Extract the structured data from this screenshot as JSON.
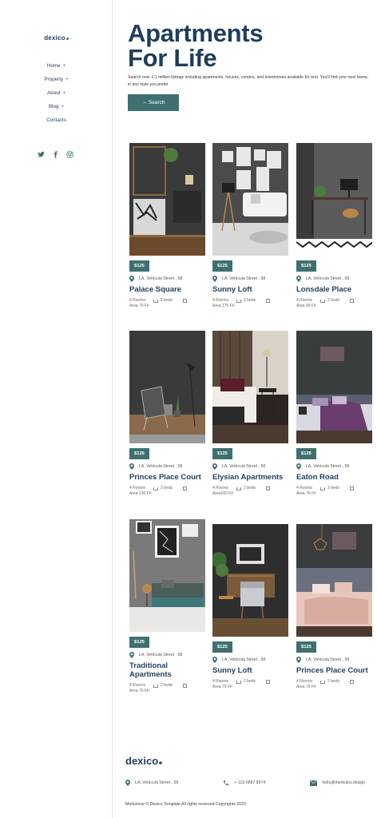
{
  "sidebar": {
    "logo": "dexico",
    "nav": [
      {
        "label": "Home",
        "plus": "+"
      },
      {
        "label": "Property",
        "plus": "+"
      },
      {
        "label": "About",
        "plus": "+"
      },
      {
        "label": "Blog",
        "plus": "+"
      },
      {
        "label": "Contacts",
        "plus": ""
      }
    ],
    "social": [
      "twitter-icon",
      "facebook-icon",
      "instagram-icon"
    ]
  },
  "hero": {
    "title_line1": "Apartments",
    "title_line2": "For Life",
    "description": "Search over 1.1 million listings including apartments, houses, condos, and townhomes available for rent. You'll find your next home, in any style you prefer",
    "search_label": "→ Search"
  },
  "listings": [
    {
      "price": "$125",
      "location": "LA, Vehicula Street , 58",
      "name": "Palace Square",
      "rooms": "4 Rooms",
      "beds": "2 beds",
      "area": "Area 70 Ft²",
      "theme": "dark-botanical"
    },
    {
      "price": "$125",
      "location": "LA, Vehicula Street , 58",
      "name": "Sunny Loft",
      "rooms": "4 Rooms",
      "beds": "2 beds",
      "area": "Area 170 Ft²",
      "theme": "gallery-sofa"
    },
    {
      "price": "$125",
      "location": "LA, Vehicula Street , 58",
      "name": "Lonsdale Place",
      "rooms": "4 Rooms",
      "beds": "2 beds",
      "area": "Area 90 Ft²",
      "theme": "desk-corner"
    },
    {
      "price": "$125",
      "location": "LA, Vehicula Street , 58",
      "name": "Princes Place Court",
      "rooms": "4 Rooms",
      "beds": "2 beds",
      "area": "Area 130 Ft²",
      "theme": "grey-chair"
    },
    {
      "price": "$125",
      "location": "LA, Vehicula Street , 58",
      "name": "Elysian Apartments",
      "rooms": "4 Rooms",
      "beds": "2 beds",
      "area": "Area100 Ft²",
      "theme": "wood-bedroom"
    },
    {
      "price": "$125",
      "location": "LA, Vehicula Street , 58",
      "name": "Eaton Road",
      "rooms": "4 Rooms",
      "beds": "2 beds",
      "area": "Area 70 Ft²",
      "theme": "purple-bed"
    },
    {
      "price": "$125",
      "location": "LA, Vehicula Street , 58",
      "name": "Traditional Apartments",
      "rooms": "4 Rooms",
      "beds": "2 beds",
      "area": "Area 70 Ft²",
      "theme": "teal-daybed"
    },
    {
      "price": "$125",
      "location": "LA, Vehicula Street , 58",
      "name": "Sunny Loft",
      "rooms": "4 Rooms",
      "beds": "2 beds",
      "area": "Area 70 Ft²",
      "theme": "armchair-lounge"
    },
    {
      "price": "$125",
      "location": "LA, Vehicula Street , 58",
      "name": "Princes Place Court",
      "rooms": "4 Rooms",
      "beds": "2 beds",
      "area": "Area 70 Ft²",
      "theme": "pink-bed"
    }
  ],
  "footer": {
    "logo": "dexico",
    "address": "LA, Vehicula Street , 58",
    "phone": "+ 123 6897 8974",
    "email": "hello@merkulov.design",
    "copyright": "Merkulove © Desico Template All rights reserved Copyrights 2020"
  },
  "colors": {
    "accent": "#3f7070",
    "heading": "#1f3d5c"
  }
}
